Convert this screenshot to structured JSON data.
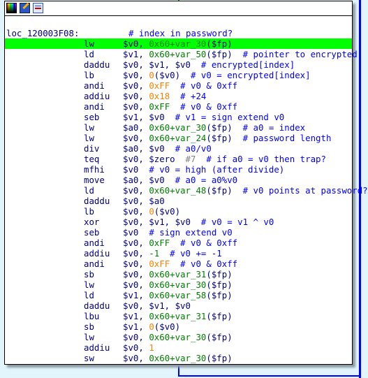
{
  "toolbar": {
    "icons": [
      "color-palette-icon",
      "edit-node-icon",
      "graph-overview-icon"
    ]
  },
  "colors": {
    "highlight": "#00ff00",
    "mnemonic": "#000080",
    "immediate": "#ff8000",
    "variable": "#008000",
    "comment": "#0000ff",
    "edge": "#0000ff",
    "background": "#e2f4fc"
  },
  "block": {
    "label": "loc_120003F08:",
    "label_comment": "# index in password?",
    "lines": [
      {
        "mn": "lw",
        "hl": true,
        "ops": [
          [
            "$v0, ",
            "reg"
          ],
          [
            "0x60+var_30",
            "var"
          ],
          [
            "($fp)",
            "reg"
          ]
        ]
      },
      {
        "mn": "ld",
        "ops": [
          [
            "$v1, ",
            "reg"
          ],
          [
            "0x60+var_50",
            "var"
          ],
          [
            "($fp)  ",
            "reg"
          ],
          [
            "# pointer to encrypted",
            "cmt"
          ]
        ]
      },
      {
        "mn": "daddu",
        "ops": [
          [
            "$v0, $v1, $v0  ",
            "reg"
          ],
          [
            "# encrypted[index]",
            "cmt"
          ]
        ]
      },
      {
        "mn": "lb",
        "ops": [
          [
            "$v0, ",
            "reg"
          ],
          [
            "0",
            "num"
          ],
          [
            "($v0)  ",
            "reg"
          ],
          [
            "# v0 = encrypted[index]",
            "cmt"
          ]
        ]
      },
      {
        "mn": "andi",
        "ops": [
          [
            "$v0, ",
            "reg"
          ],
          [
            "0xFF",
            "num"
          ],
          [
            "  # v0 & 0xff",
            "cmt"
          ]
        ]
      },
      {
        "mn": "addiu",
        "ops": [
          [
            "$v0, ",
            "reg"
          ],
          [
            "0x18",
            "num"
          ],
          [
            "  # +24",
            "cmt"
          ]
        ]
      },
      {
        "mn": "andi",
        "ops": [
          [
            "$v0, ",
            "reg"
          ],
          [
            "0xFF",
            "var"
          ],
          [
            "  # v0 & 0xff",
            "cmt"
          ]
        ]
      },
      {
        "mn": "seb",
        "ops": [
          [
            "$v1, $v0  ",
            "reg"
          ],
          [
            "# v1 = sign extend v0",
            "cmt"
          ]
        ]
      },
      {
        "mn": "lw",
        "ops": [
          [
            "$a0, ",
            "reg"
          ],
          [
            "0x60+var_30",
            "var"
          ],
          [
            "($fp)  ",
            "reg"
          ],
          [
            "# a0 = index",
            "cmt"
          ]
        ]
      },
      {
        "mn": "lw",
        "ops": [
          [
            "$v0, ",
            "reg"
          ],
          [
            "0x60+var_24",
            "var"
          ],
          [
            "($fp)  ",
            "reg"
          ],
          [
            "# password length",
            "cmt"
          ]
        ]
      },
      {
        "mn": "div",
        "ops": [
          [
            "$a0, $v0  ",
            "reg"
          ],
          [
            "# a0/v0",
            "cmt"
          ]
        ]
      },
      {
        "mn": "teq",
        "ops": [
          [
            "$v0, $zero  ",
            "reg"
          ],
          [
            "#7",
            "gray"
          ],
          [
            "  # if a0 = v0 then trap?",
            "cmt"
          ]
        ]
      },
      {
        "mn": "mfhi",
        "ops": [
          [
            "$v0  ",
            "reg"
          ],
          [
            "# v0 = high (after divide)",
            "cmt"
          ]
        ]
      },
      {
        "mn": "move",
        "ops": [
          [
            "$a0, $v0  ",
            "reg"
          ],
          [
            "# a0 = a0%v0",
            "cmt"
          ]
        ]
      },
      {
        "mn": "ld",
        "ops": [
          [
            "$v0, ",
            "reg"
          ],
          [
            "0x60+var_48",
            "var"
          ],
          [
            "($fp)  ",
            "reg"
          ],
          [
            "# v0 points at password?",
            "cmt"
          ]
        ]
      },
      {
        "mn": "daddu",
        "ops": [
          [
            "$v0, $a0",
            "reg"
          ]
        ]
      },
      {
        "mn": "lb",
        "ops": [
          [
            "$v0, ",
            "reg"
          ],
          [
            "0",
            "num"
          ],
          [
            "($v0)",
            "reg"
          ]
        ]
      },
      {
        "mn": "xor",
        "ops": [
          [
            "$v0, $v1, $v0  ",
            "reg"
          ],
          [
            "# v0 = v1 ^ v0",
            "cmt"
          ]
        ]
      },
      {
        "mn": "seb",
        "ops": [
          [
            "$v0  ",
            "reg"
          ],
          [
            "# sign extend v0",
            "cmt"
          ]
        ]
      },
      {
        "mn": "andi",
        "ops": [
          [
            "$v0, ",
            "reg"
          ],
          [
            "0xFF",
            "var"
          ],
          [
            "  # v0 & 0xff",
            "cmt"
          ]
        ]
      },
      {
        "mn": "addiu",
        "ops": [
          [
            "$v0, ",
            "reg"
          ],
          [
            "-1",
            "var"
          ],
          [
            "  # v0 += -1",
            "cmt"
          ]
        ]
      },
      {
        "mn": "andi",
        "ops": [
          [
            "$v0, ",
            "reg"
          ],
          [
            "0xFF",
            "num"
          ],
          [
            "  # v0 & 0xff",
            "cmt"
          ]
        ]
      },
      {
        "mn": "sb",
        "ops": [
          [
            "$v0, ",
            "reg"
          ],
          [
            "0x60+var_31",
            "var"
          ],
          [
            "($fp)",
            "reg"
          ]
        ]
      },
      {
        "mn": "lw",
        "ops": [
          [
            "$v0, ",
            "reg"
          ],
          [
            "0x60+var_30",
            "var"
          ],
          [
            "($fp)",
            "reg"
          ]
        ]
      },
      {
        "mn": "ld",
        "ops": [
          [
            "$v1, ",
            "reg"
          ],
          [
            "0x60+var_58",
            "var"
          ],
          [
            "($fp)",
            "reg"
          ]
        ]
      },
      {
        "mn": "daddu",
        "ops": [
          [
            "$v0, $v1, $v0",
            "reg"
          ]
        ]
      },
      {
        "mn": "lbu",
        "ops": [
          [
            "$v1, ",
            "reg"
          ],
          [
            "0x60+var_31",
            "var"
          ],
          [
            "($fp)",
            "reg"
          ]
        ]
      },
      {
        "mn": "sb",
        "ops": [
          [
            "$v1, ",
            "reg"
          ],
          [
            "0",
            "num"
          ],
          [
            "($v0)",
            "reg"
          ]
        ]
      },
      {
        "mn": "lw",
        "ops": [
          [
            "$v0, ",
            "reg"
          ],
          [
            "0x60+var_30",
            "var"
          ],
          [
            "($fp)",
            "reg"
          ]
        ]
      },
      {
        "mn": "addiu",
        "ops": [
          [
            "$v0, ",
            "reg"
          ],
          [
            "1",
            "num"
          ]
        ]
      },
      {
        "mn": "sw",
        "ops": [
          [
            "$v0, ",
            "reg"
          ],
          [
            "0x60+var_30",
            "var"
          ],
          [
            "($fp)",
            "reg"
          ]
        ]
      }
    ]
  }
}
